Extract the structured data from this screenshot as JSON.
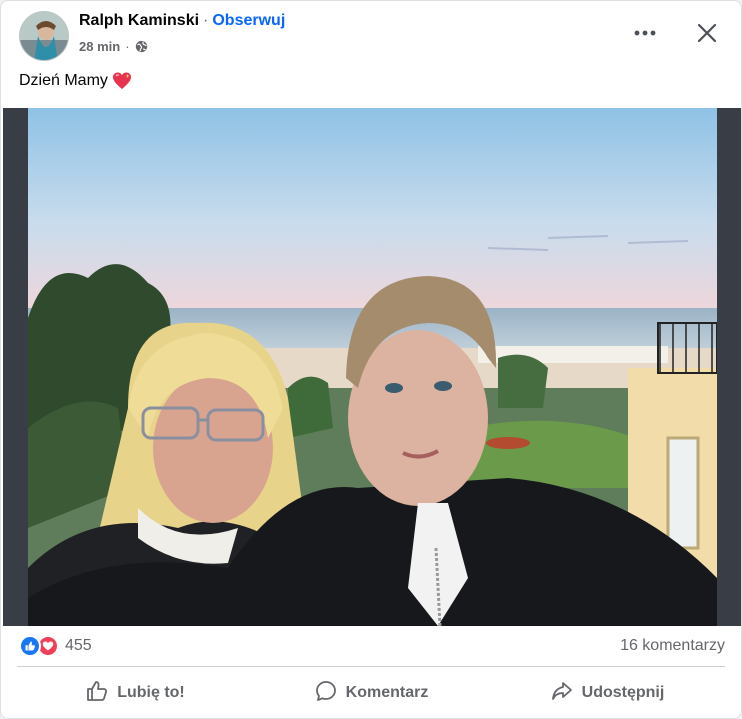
{
  "post": {
    "author": "Ralph Kaminski",
    "separator": "·",
    "follow_label": "Obserwuj",
    "time": "28 min",
    "privacy_icon": "globe-icon",
    "text": "Dzień Mamy",
    "text_emoji": "sparkling-heart-icon"
  },
  "header": {
    "more_icon": "more-options-icon",
    "close_icon": "close-icon"
  },
  "stats": {
    "reaction_icons": [
      "like-icon",
      "love-icon"
    ],
    "reactions_count": "455",
    "comments_label": "16 komentarzy"
  },
  "actions": {
    "like_label": "Lubię to!",
    "comment_label": "Komentarz",
    "share_label": "Udostępnij"
  },
  "colors": {
    "brand_blue": "#0866ff",
    "secondary_text": "#65676b",
    "like_blue": "#1877f2",
    "love_red": "#f33e58"
  }
}
